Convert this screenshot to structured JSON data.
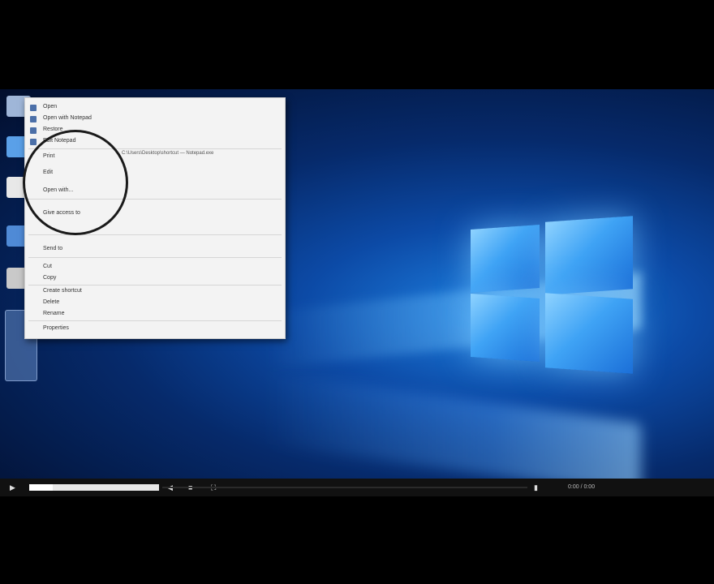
{
  "desktop": {
    "icons": [
      "recycle-bin",
      "computer",
      "document",
      "network",
      "folder",
      "shortcut"
    ]
  },
  "context_menu": {
    "items": [
      {
        "label": "Open"
      },
      {
        "label": "Open with Notepad"
      },
      {
        "label": "Restore"
      },
      {
        "label": "Edit Notepad"
      },
      {
        "label": "Print"
      },
      {
        "label": "Edit"
      },
      {
        "label": "Open with..."
      },
      {
        "label": "Give access to"
      },
      {
        "label": "Send to"
      },
      {
        "label": "Cut"
      },
      {
        "label": "Copy"
      },
      {
        "label": "Create shortcut"
      },
      {
        "label": "Delete"
      },
      {
        "label": "Rename"
      },
      {
        "label": "Properties"
      }
    ],
    "path_hint": "C:\\Users\\Desktop\\shortcut — Notepad.exe"
  },
  "player": {
    "play_icon": "play-icon",
    "progress": 0.18,
    "time": "0:00 / 0:00",
    "volume_icon": "volume-icon",
    "settings_icon": "gear-icon",
    "fullscreen_icon": "fullscreen-icon"
  }
}
